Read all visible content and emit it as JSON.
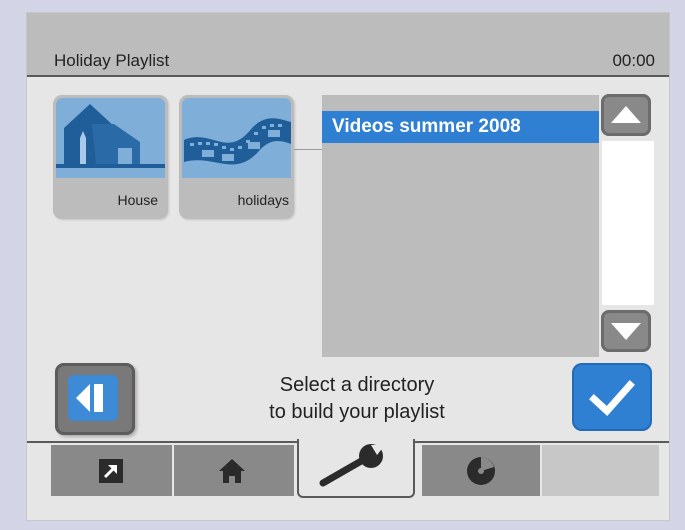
{
  "header": {
    "title": "Holiday Playlist",
    "time": "00:00"
  },
  "folders": [
    {
      "label": "House",
      "icon": "house-icon"
    },
    {
      "label": "holidays",
      "icon": "film-strip-icon"
    }
  ],
  "list": {
    "items": [
      "Videos summer 2008"
    ],
    "selected_index": 0
  },
  "footer": {
    "hint_line1": "Select a directory",
    "hint_line2": "to build your playlist"
  },
  "tabs": [
    {
      "icon": "external-link-icon",
      "active": false
    },
    {
      "icon": "home-icon",
      "active": false
    },
    {
      "icon": "wrench-icon",
      "active": true
    },
    {
      "icon": "disc-icon",
      "active": false
    },
    {
      "icon": "",
      "active": false
    }
  ],
  "colors": {
    "accent": "#2f7fd2",
    "titlebar": "#bdbcbc",
    "background": "#e7e6e6",
    "button_gray": "#8a8989"
  }
}
